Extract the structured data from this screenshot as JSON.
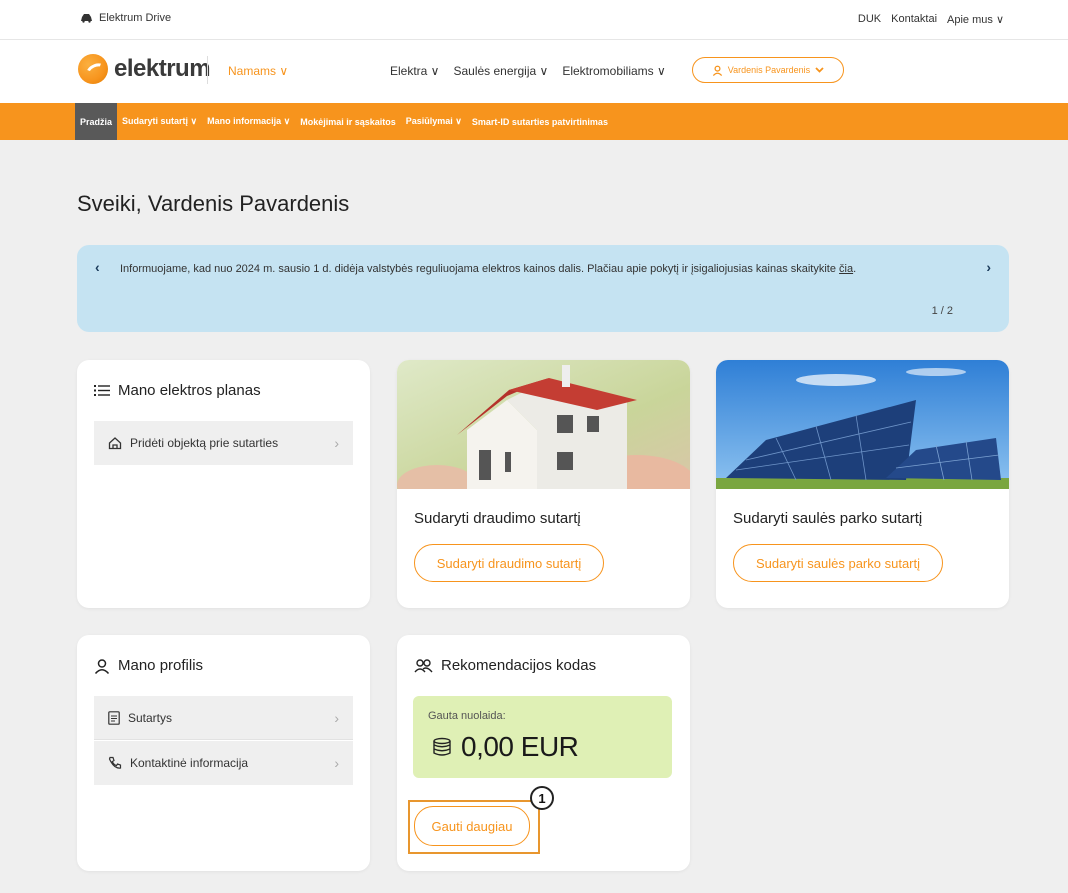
{
  "topbar": {
    "brand": "Elektrum Drive",
    "links": [
      "DUK",
      "Kontaktai",
      "Apie mus ∨"
    ]
  },
  "header": {
    "logo_text": "elektrum",
    "segment": "Namams ∨",
    "nav": [
      "Elektra ∨",
      "Saulės energija ∨",
      "Elektromobiliams ∨"
    ],
    "user": "Vardenis Pavardenis"
  },
  "subnav": {
    "items": [
      "Pradžia",
      "Sudaryti sutartį ∨",
      "Mano informacija ∨",
      "Mokėjimai ir sąskaitos",
      "Pasiūlymai ∨",
      "Smart-ID sutarties patvirtinimas"
    ]
  },
  "greeting": "Sveiki, Vardenis Pavardenis",
  "banner": {
    "text": "Informuojame, kad nuo 2024 m. sausio 1 d. didėja valstybės reguliuojama elektros kainos dalis. Plačiau apie pokytį ir įsigaliojusias kainas skaitykite ",
    "link": "čia",
    "text_end": ".",
    "pager": "1 / 2",
    "prev": "‹",
    "next": "›"
  },
  "plan_card": {
    "title": "Mano elektros planas",
    "item": "Pridėti objektą prie sutarties"
  },
  "insurance_card": {
    "title": "Sudaryti draudimo sutartį",
    "button": "Sudaryti draudimo sutartį"
  },
  "solar_card": {
    "title": "Sudaryti saulės parko sutartį",
    "button": "Sudaryti saulės parko sutartį"
  },
  "profile_card": {
    "title": "Mano profilis",
    "items": [
      "Sutartys",
      "Kontaktinė informacija"
    ]
  },
  "referral_card": {
    "title": "Rekomendacijos kodas",
    "discount_label": "Gauta nuolaida:",
    "discount_value": "0,00 EUR",
    "button": "Gauti daugiau"
  },
  "annotation": {
    "badge": "1"
  },
  "colors": {
    "accent": "#f7941d",
    "banner_bg": "#c5e3f2",
    "discount_bg": "#dff0b5"
  }
}
